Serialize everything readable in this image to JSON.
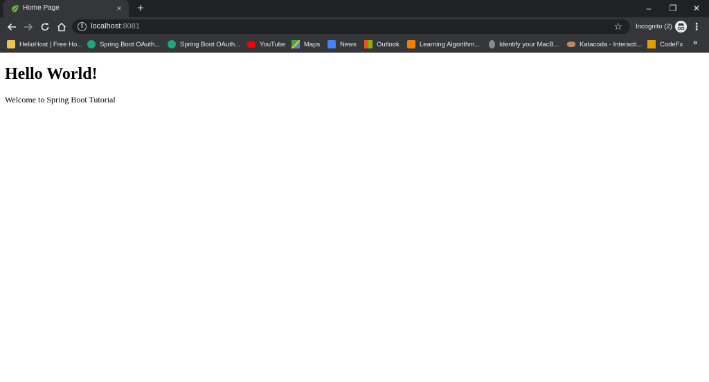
{
  "browser": {
    "tab": {
      "title": "Home Page",
      "close_glyph": "×"
    },
    "new_tab_glyph": "+",
    "window": {
      "minimize": "–",
      "restore": "❐",
      "close": "✕"
    },
    "url": {
      "host": "localhost",
      "port": ":8081"
    },
    "incognito_label": "Incognito (2)",
    "bookmarks": [
      {
        "label": "HelioHost | Free Ho...",
        "icon": "heliohost-icon",
        "color": "#f0c24b"
      },
      {
        "label": "Spring Boot OAuth...",
        "icon": "spring-oauth-icon",
        "color": "#1fa67a"
      },
      {
        "label": "Spring Boot OAuth...",
        "icon": "spring-oauth-icon",
        "color": "#1fa67a"
      },
      {
        "label": "YouTube",
        "icon": "youtube-icon",
        "color": "#ff0000"
      },
      {
        "label": "Maps",
        "icon": "maps-icon",
        "color": "#34a853"
      },
      {
        "label": "News",
        "icon": "news-icon",
        "color": "#4285f4"
      },
      {
        "label": "Outlook",
        "icon": "outlook-icon",
        "color": "#0078d4"
      },
      {
        "label": "Learning Algorithm...",
        "icon": "blogger-icon",
        "color": "#f57d00"
      },
      {
        "label": "Identify your MacB...",
        "icon": "apple-icon",
        "color": "#a0a0a0"
      },
      {
        "label": "Katacoda - Interacti...",
        "icon": "katacoda-icon",
        "color": "#c0875a"
      },
      {
        "label": "CodeFx",
        "icon": "codefx-icon",
        "color": "#e69b00"
      }
    ],
    "bookmarks_more": "»"
  },
  "page": {
    "heading": "Hello World!",
    "paragraph": "Welcome to Spring Boot Tutorial"
  },
  "colors": {
    "tabstrip_bg": "#202124",
    "toolbar_bg": "#35363a",
    "spring_green": "#6db33f"
  }
}
